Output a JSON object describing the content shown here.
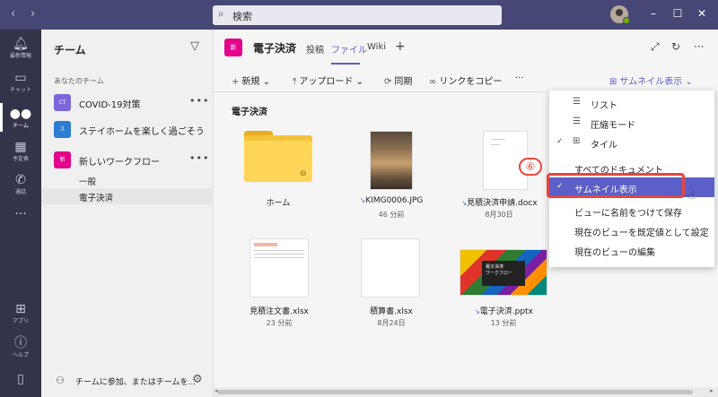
{
  "search": {
    "placeholder": "検索"
  },
  "rail": [
    {
      "label": "最新情報",
      "icon": "bell-icon"
    },
    {
      "label": "チャット",
      "icon": "chat-icon"
    },
    {
      "label": "チーム",
      "icon": "teams-icon"
    },
    {
      "label": "予定表",
      "icon": "calendar-icon"
    },
    {
      "label": "通話",
      "icon": "phone-icon"
    },
    {
      "label": "アプリ",
      "icon": "apps-icon"
    },
    {
      "label": "ヘルプ",
      "icon": "help-icon"
    }
  ],
  "teams_panel": {
    "title": "チーム",
    "section": "あなたのチーム",
    "teams": [
      {
        "initials": "CT",
        "name": "COVID-19対策",
        "color": "#7b67d9"
      },
      {
        "initials": "ス",
        "name": "ステイホームを楽しく過ごそう",
        "color": "#2b7cd3"
      },
      {
        "initials": "新",
        "name": "新しいワークフロー",
        "color": "#e3008c"
      }
    ],
    "channels": [
      "一般",
      "電子決済"
    ],
    "join": "チームに参加、またはチームを..."
  },
  "header": {
    "tile": "新",
    "title": "電子決済",
    "tabs": [
      "投稿",
      "ファイル",
      "Wiki"
    ],
    "active_tab": "ファイル"
  },
  "toolbar": {
    "new": "新規",
    "upload": "アップロード",
    "sync": "同期",
    "copy_link": "リンクをコピー",
    "more": "···",
    "view": "サムネイル表示"
  },
  "breadcrumb": "電子決済",
  "files": [
    {
      "name": "ホーム",
      "meta": ""
    },
    {
      "name": "KIMG0006.JPG",
      "meta": "46 分前"
    },
    {
      "name": "見積決済申請.docx",
      "meta": "8月30日"
    },
    {
      "name": "見積注文書.xlsx",
      "meta": "23 分前"
    },
    {
      "name": "積算書.xlsx",
      "meta": "8月24日"
    },
    {
      "name": "電子決済.pptx",
      "meta": "13 分前"
    }
  ],
  "slide_text": {
    "title": "電子決済",
    "subtitle": "ワークフロー"
  },
  "view_menu": {
    "items": [
      {
        "label": "リスト",
        "icon": "list-icon",
        "checked": false
      },
      {
        "label": "圧縮モード",
        "icon": "compact-icon",
        "checked": false
      },
      {
        "label": "タイル",
        "icon": "tile-icon",
        "checked": true
      },
      {
        "label": "すべてのドキュメント",
        "checked": false
      },
      {
        "label": "サムネイル表示",
        "checked": true,
        "highlighted": true
      },
      {
        "label": "ビューに名前をつけて保存",
        "checked": false
      },
      {
        "label": "現在のビューを既定値として設定",
        "checked": false
      },
      {
        "label": "現在のビューの編集",
        "checked": false
      }
    ]
  },
  "step_badge": "⑥",
  "colors": {
    "accent": "#5b5fc7",
    "titlebar": "#464775",
    "rail": "#33344a",
    "callout": "#e8453c"
  }
}
